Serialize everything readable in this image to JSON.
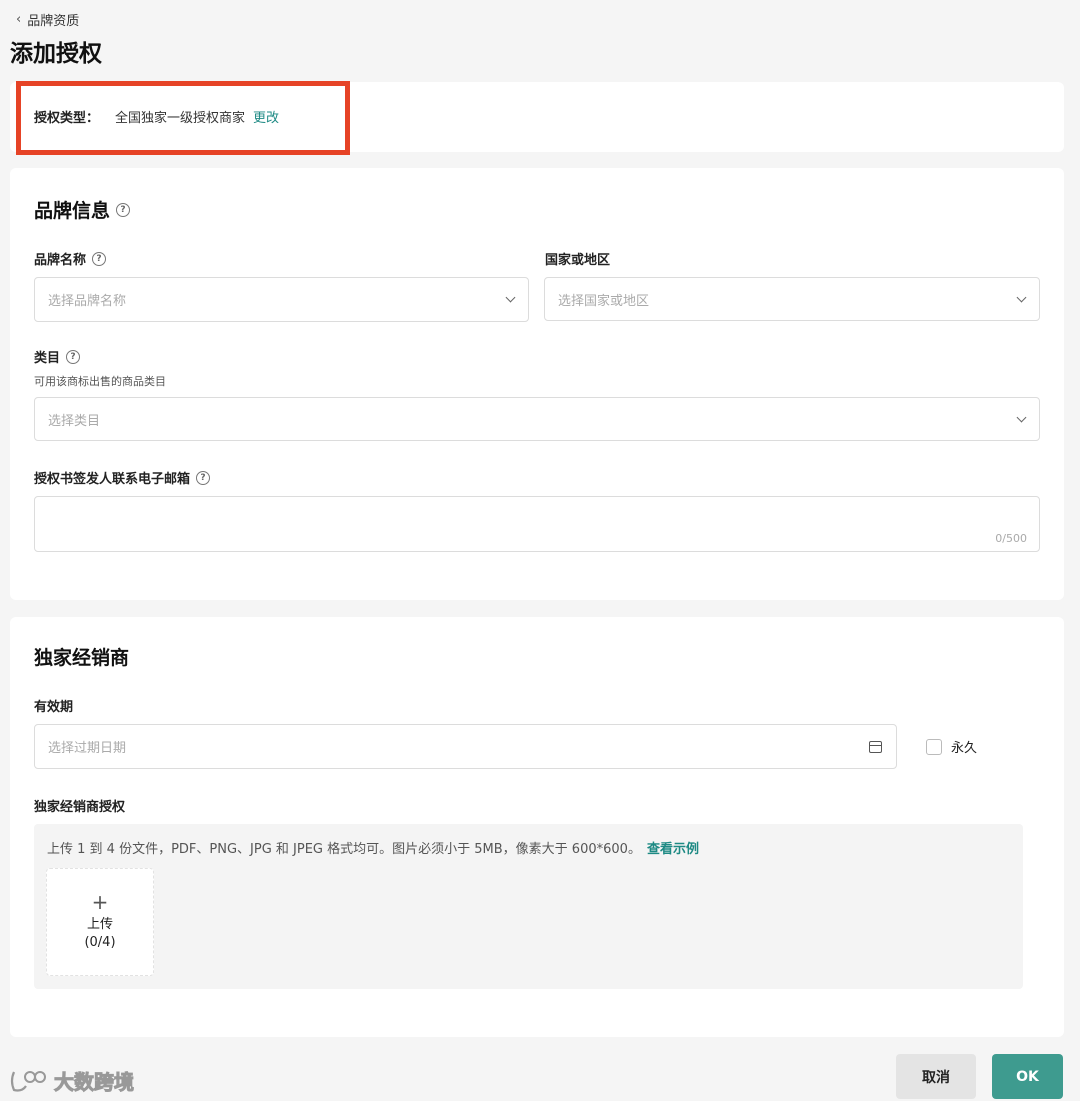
{
  "header": {
    "back_label": "品牌资质",
    "title": "添加授权"
  },
  "auth": {
    "label": "授权类型：",
    "value": "全国独家一级授权商家",
    "change": "更改",
    "highlight_color": "#e64326"
  },
  "brand_section": {
    "title": "品牌信息",
    "brand_name": {
      "label": "品牌名称",
      "placeholder": "选择品牌名称"
    },
    "country": {
      "label": "国家或地区",
      "placeholder": "选择国家或地区"
    },
    "category": {
      "label": "类目",
      "sub": "可用该商标出售的商品类目",
      "placeholder": "选择类目"
    },
    "email": {
      "label": "授权书签发人联系电子邮箱",
      "counter": "0/500"
    }
  },
  "dist_section": {
    "title": "独家经销商",
    "validity": {
      "label": "有效期",
      "placeholder": "选择过期日期",
      "permanent": "永久"
    },
    "auth_docs": {
      "label": "独家经销商授权",
      "hint": "上传 1 到 4 份文件，PDF、PNG、JPG 和 JPEG 格式均可。图片必须小于 5MB，像素大于 600*600。",
      "example_link": "查看示例",
      "upload_label": "上传",
      "upload_count": "(0/4)"
    }
  },
  "footer": {
    "cancel": "取消",
    "ok": "OK",
    "accent": "#3e9b8f"
  },
  "watermark": {
    "text": "大数跨境"
  }
}
